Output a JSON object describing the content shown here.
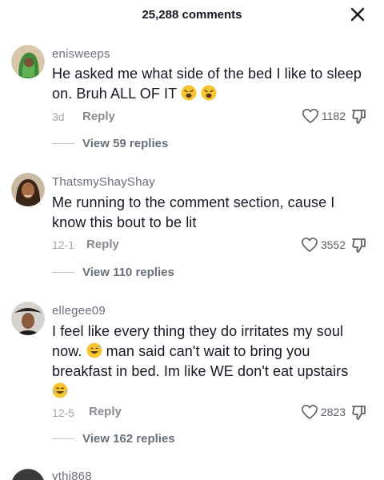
{
  "header": {
    "title": "25,288 comments",
    "close_icon": "close-icon"
  },
  "comments": [
    {
      "username": "enisweeps",
      "line1": "He asked me what side of the bed I like to sleep",
      "line2": "on. Bruh ALL OF IT",
      "date": "3d",
      "reply_label": "Reply",
      "likes": "1182",
      "view_replies": "View 59 replies"
    },
    {
      "username": "ThatsmyShayShay",
      "line1": "Me running to the comment section, cause I",
      "line2": "know this bout to be lit",
      "date": "12-1",
      "reply_label": "Reply",
      "likes": "3552",
      "view_replies": "View 110 replies"
    },
    {
      "username": "ellegee09",
      "line1": "I feel like every thing they do irritates my soul",
      "line2a": "now.",
      "line2b": "man said can't wait to bring you",
      "line3": "breakfast in bed. Im like WE don't eat upstairs",
      "date": "12-5",
      "reply_label": "Reply",
      "likes": "2823",
      "view_replies": "View 162 replies"
    },
    {
      "username": "ythi868"
    }
  ],
  "colors": {
    "text": "#161823",
    "muted": "#a4a6ab",
    "username": "#6b6f78"
  }
}
